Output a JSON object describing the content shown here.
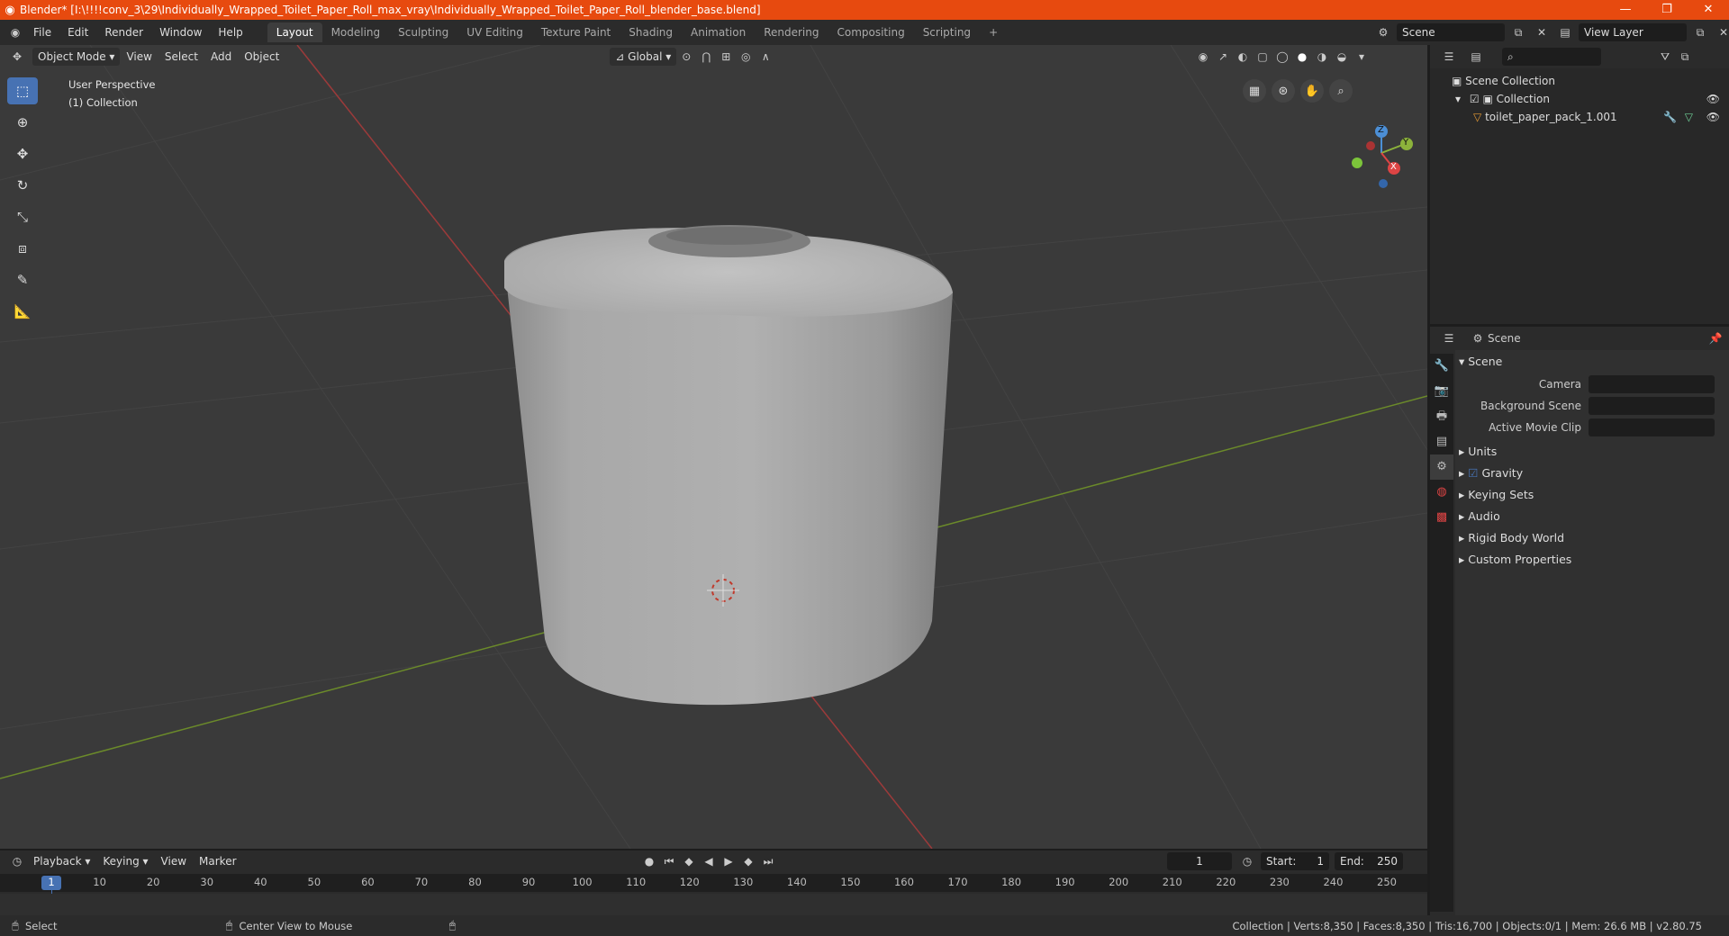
{
  "window": {
    "title": "Blender* [I:\\!!!!conv_3\\29\\Individually_Wrapped_Toilet_Paper_Roll_max_vray\\Individually_Wrapped_Toilet_Paper_Roll_blender_base.blend]",
    "minimize": "—",
    "maximize": "❐",
    "close": "✕"
  },
  "menu": [
    "File",
    "Edit",
    "Render",
    "Window",
    "Help"
  ],
  "workspaces": [
    "Layout",
    "Modeling",
    "Sculpting",
    "UV Editing",
    "Texture Paint",
    "Shading",
    "Animation",
    "Rendering",
    "Compositing",
    "Scripting"
  ],
  "add_workspace": "+",
  "scene_name": "Scene",
  "view_layer": "View Layer",
  "viewport_header": {
    "mode": "Object Mode",
    "menus": [
      "View",
      "Select",
      "Add",
      "Object"
    ],
    "transform_orientation": "Global"
  },
  "viewport_info": {
    "line1": "User Perspective",
    "line2": "(1) Collection"
  },
  "gizmo": {
    "x": "X",
    "y": "Y",
    "z": "Z"
  },
  "outliner": {
    "root": "Scene Collection",
    "collection": "Collection",
    "object": "toilet_paper_pack_1.001"
  },
  "properties": {
    "context": "Scene",
    "panel_title": "Scene",
    "fields": {
      "camera": "Camera",
      "background_scene": "Background Scene",
      "active_movie_clip": "Active Movie Clip"
    },
    "panels": [
      "Units",
      "Gravity",
      "Keying Sets",
      "Audio",
      "Rigid Body World",
      "Custom Properties"
    ]
  },
  "timeline": {
    "menus": [
      "Playback",
      "Keying",
      "View",
      "Marker"
    ],
    "current_frame": "1",
    "start_label": "Start:",
    "start": "1",
    "end_label": "End:",
    "end": "250",
    "ticks": [
      "1",
      "10",
      "20",
      "30",
      "40",
      "50",
      "60",
      "70",
      "80",
      "90",
      "100",
      "110",
      "120",
      "130",
      "140",
      "150",
      "160",
      "170",
      "180",
      "190",
      "200",
      "210",
      "220",
      "230",
      "240",
      "250"
    ]
  },
  "statusbar": {
    "left": "Select",
    "middle": "Center View to Mouse",
    "right": "Collection | Verts:8,350 | Faces:8,350 | Tris:16,700 | Objects:0/1 | Mem: 26.6 MB | v2.80.75"
  }
}
